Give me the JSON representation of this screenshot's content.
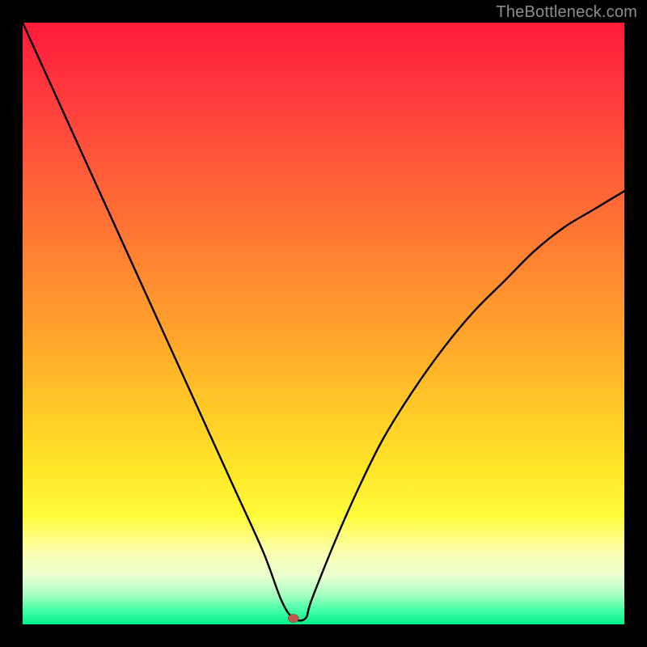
{
  "watermark": "TheBottleneck.com",
  "chart_data": {
    "type": "line",
    "title": "",
    "xlabel": "",
    "ylabel": "",
    "xlim": [
      0,
      100
    ],
    "ylim": [
      0,
      100
    ],
    "grid": false,
    "legend": false,
    "marker": {
      "x": 45,
      "y": 1,
      "color": "#c25a4a"
    },
    "series": [
      {
        "name": "bottleneck-curve",
        "x": [
          0,
          5,
          10,
          15,
          20,
          25,
          30,
          35,
          40,
          43,
          45,
          47,
          48,
          52,
          56,
          60,
          65,
          70,
          75,
          80,
          85,
          90,
          95,
          100
        ],
        "values": [
          100,
          89,
          78,
          67,
          56,
          45,
          34,
          23,
          12,
          4,
          1,
          1,
          4,
          14,
          23,
          31,
          39,
          46,
          52,
          57,
          62,
          66,
          69,
          72
        ]
      }
    ],
    "background_gradient_stops": [
      {
        "pos": 0,
        "color": "#ff1a3a"
      },
      {
        "pos": 0.5,
        "color": "#ffaa2a"
      },
      {
        "pos": 0.82,
        "color": "#fffb3a"
      },
      {
        "pos": 1.0,
        "color": "#00f08a"
      }
    ]
  }
}
